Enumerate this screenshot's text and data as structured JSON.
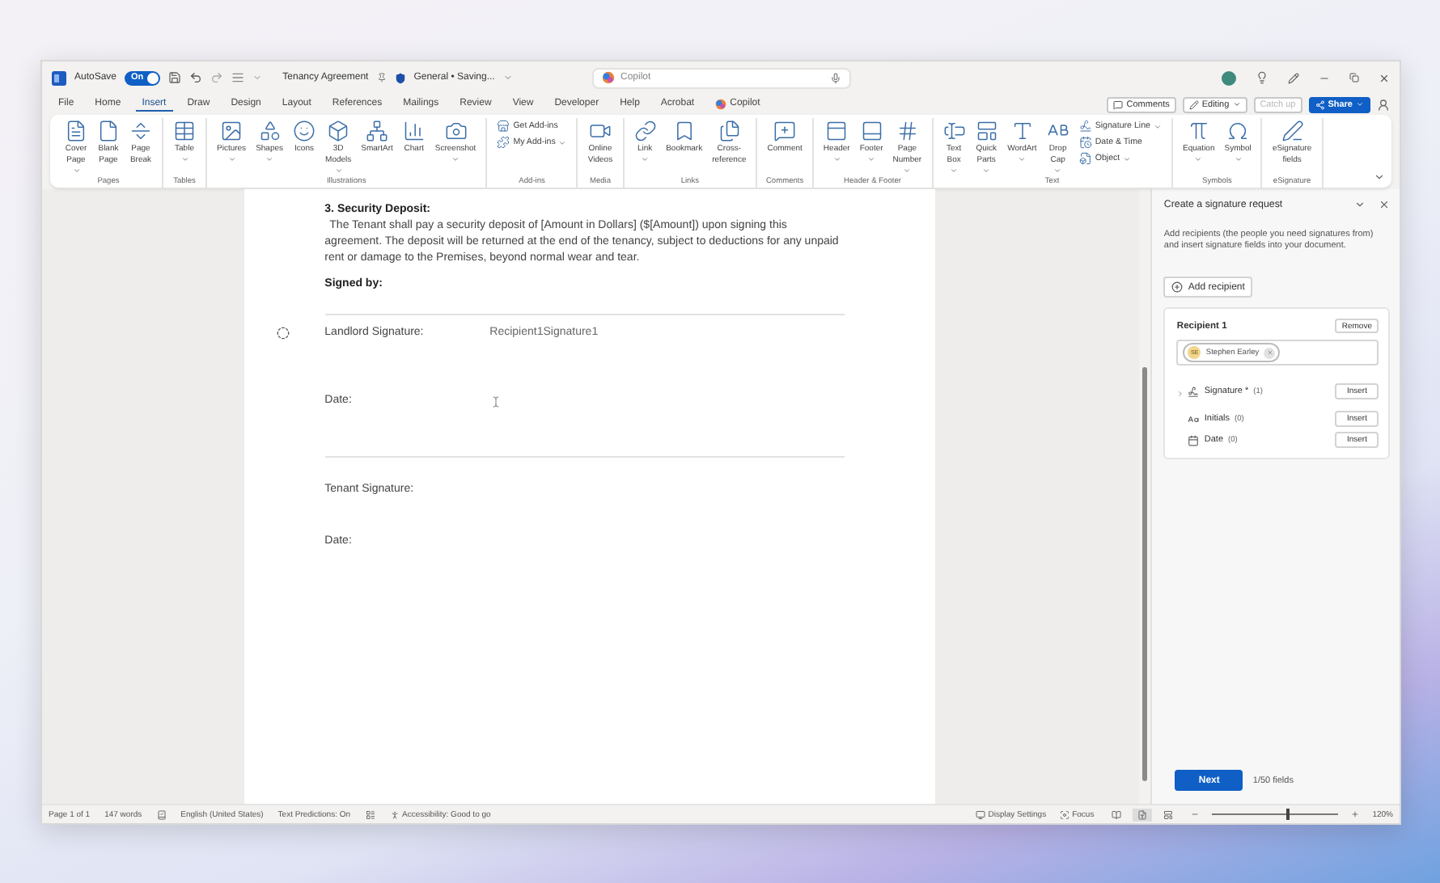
{
  "title_bar": {
    "autosave_label": "AutoSave",
    "autosave_on": true,
    "toggle_text": "On",
    "document_title": "Tenancy Agreement",
    "sensitivity": "General • Saving...",
    "search": {
      "placeholder": "Copilot"
    }
  },
  "menu_tabs": [
    {
      "label": "File",
      "selected": false,
      "kind": "plain"
    },
    {
      "label": "Home",
      "selected": false,
      "kind": "plain"
    },
    {
      "label": "Insert",
      "selected": true,
      "kind": "plain"
    },
    {
      "label": "Draw",
      "selected": false,
      "kind": "plain"
    },
    {
      "label": "Design",
      "selected": false,
      "kind": "plain"
    },
    {
      "label": "Layout",
      "selected": false,
      "kind": "plain"
    },
    {
      "label": "References",
      "selected": false,
      "kind": "plain"
    },
    {
      "label": "Mailings",
      "selected": false,
      "kind": "plain"
    },
    {
      "label": "Review",
      "selected": false,
      "kind": "plain"
    },
    {
      "label": "View",
      "selected": false,
      "kind": "plain"
    },
    {
      "label": "Developer",
      "selected": false,
      "kind": "plain"
    },
    {
      "label": "Help",
      "selected": false,
      "kind": "plain"
    },
    {
      "label": "Acrobat",
      "selected": false,
      "kind": "plain"
    },
    {
      "label": "Copilot",
      "selected": false,
      "kind": "logo"
    }
  ],
  "actions": {
    "comments": "Comments",
    "editing": "Editing",
    "catch_up": {
      "label": "Catch up",
      "disabled": true
    },
    "share": "Share"
  },
  "ribbon": {
    "groups": [
      {
        "name": "Pages",
        "items": [
          {
            "kind": "large",
            "lines": [
              "Cover",
              "Page"
            ],
            "dropdown": true
          },
          {
            "kind": "large",
            "lines": [
              "Blank",
              "Page"
            ],
            "dropdown": false
          },
          {
            "kind": "large",
            "lines": [
              "Page",
              "Break"
            ],
            "dropdown": false
          }
        ]
      },
      {
        "name": "Tables",
        "items": [
          {
            "kind": "large",
            "lines": [
              "Table"
            ],
            "dropdown": true
          }
        ]
      },
      {
        "name": "Illustrations",
        "items": [
          {
            "kind": "large",
            "lines": [
              "Pictures"
            ],
            "dropdown": true
          },
          {
            "kind": "large",
            "lines": [
              "Shapes"
            ],
            "dropdown": true
          },
          {
            "kind": "large",
            "lines": [
              "Icons"
            ],
            "dropdown": false
          },
          {
            "kind": "large",
            "lines": [
              "3D",
              "Models"
            ],
            "dropdown": true
          },
          {
            "kind": "large",
            "lines": [
              "SmartArt"
            ],
            "dropdown": false
          },
          {
            "kind": "large",
            "lines": [
              "Chart"
            ],
            "dropdown": false
          },
          {
            "kind": "large",
            "lines": [
              "Screenshot"
            ],
            "dropdown": true
          }
        ]
      },
      {
        "name": "Add-ins",
        "items": [
          {
            "kind": "small",
            "lines": [
              "Get Add-ins"
            ],
            "dropdown": false
          },
          {
            "kind": "small",
            "lines": [
              "My Add-ins"
            ],
            "dropdown": true
          }
        ]
      },
      {
        "name": "Media",
        "items": [
          {
            "kind": "large",
            "lines": [
              "Online",
              "Videos"
            ],
            "dropdown": false
          }
        ]
      },
      {
        "name": "Links",
        "items": [
          {
            "kind": "large",
            "lines": [
              "Link"
            ],
            "dropdown": true
          },
          {
            "kind": "large",
            "lines": [
              "Bookmark"
            ],
            "dropdown": false
          },
          {
            "kind": "large",
            "lines": [
              "Cross-",
              "reference"
            ],
            "dropdown": false
          }
        ]
      },
      {
        "name": "Comments",
        "items": [
          {
            "kind": "large",
            "lines": [
              "Comment"
            ],
            "dropdown": false
          }
        ]
      },
      {
        "name": "Header & Footer",
        "items": [
          {
            "kind": "large",
            "lines": [
              "Header"
            ],
            "dropdown": true
          },
          {
            "kind": "large",
            "lines": [
              "Footer"
            ],
            "dropdown": true
          },
          {
            "kind": "large",
            "lines": [
              "Page",
              "Number"
            ],
            "dropdown": true
          }
        ]
      },
      {
        "name": "Text",
        "items": [
          {
            "kind": "large",
            "lines": [
              "Text",
              "Box"
            ],
            "dropdown": true
          },
          {
            "kind": "large",
            "lines": [
              "Quick",
              "Parts"
            ],
            "dropdown": true
          },
          {
            "kind": "large",
            "lines": [
              "WordArt"
            ],
            "dropdown": true
          },
          {
            "kind": "large",
            "lines": [
              "Drop",
              "Cap"
            ],
            "dropdown": true
          },
          {
            "kind": "small",
            "lines": [
              "Signature Line"
            ],
            "dropdown": true
          },
          {
            "kind": "small",
            "lines": [
              "Date & Time"
            ],
            "dropdown": false
          },
          {
            "kind": "small",
            "lines": [
              "Object"
            ],
            "dropdown": true
          }
        ]
      },
      {
        "name": "Symbols",
        "items": [
          {
            "kind": "large",
            "lines": [
              "Equation"
            ],
            "dropdown": true
          },
          {
            "kind": "large",
            "lines": [
              "Symbol"
            ],
            "dropdown": true
          }
        ]
      },
      {
        "name": "eSignature",
        "items": [
          {
            "kind": "large",
            "lines": [
              "eSignature",
              "fields"
            ],
            "dropdown": false
          }
        ]
      }
    ]
  },
  "document": {
    "heading": "3. Security Deposit:",
    "paragraph": "The Tenant shall pay a security deposit of [Amount in Dollars] ($[Amount]) upon signing this agreement. The deposit will be returned at the end of the tenancy, subject to deductions for any unpaid rent or damage to the Premises, beyond normal wear and tear.",
    "signed_by": "Signed by:",
    "blocks": [
      {
        "signature_label": "Landlord Signature:",
        "signature_field": "Recipient1Signature1",
        "date_label": "Date:"
      },
      {
        "signature_label": "Tenant Signature:",
        "date_label": "Date:"
      }
    ]
  },
  "side_panel": {
    "title": "Create a signature request",
    "description": "Add recipients (the people you need signatures from) and insert signature fields into your document.",
    "add_button": "Add recipient",
    "recipients": [
      {
        "heading": "Recipient 1",
        "remove_button": "Remove",
        "person": {
          "initials": "SE",
          "name": "Stephen Earley"
        },
        "fields": [
          {
            "label": "Signature *",
            "count": "(1)",
            "expandable": true,
            "button": "Insert"
          },
          {
            "label": "Initials",
            "count": "(0)",
            "expandable": false,
            "button": "Insert"
          },
          {
            "label": "Date",
            "count": "(0)",
            "expandable": false,
            "button": "Insert"
          }
        ]
      }
    ],
    "next_button": "Next",
    "field_count": "1/50 fields"
  },
  "status_bar": {
    "page": "Page 1 of 1",
    "words": "147 words",
    "language": "English (United States)",
    "predictions": "Text Predictions: On",
    "accessibility": "Accessibility: Good to go",
    "display_settings": "Display Settings",
    "focus": "Focus",
    "views": [
      {
        "selected": false
      },
      {
        "selected": true
      },
      {
        "selected": false
      }
    ],
    "zoom": {
      "level": 0.6,
      "label": "120%"
    }
  }
}
